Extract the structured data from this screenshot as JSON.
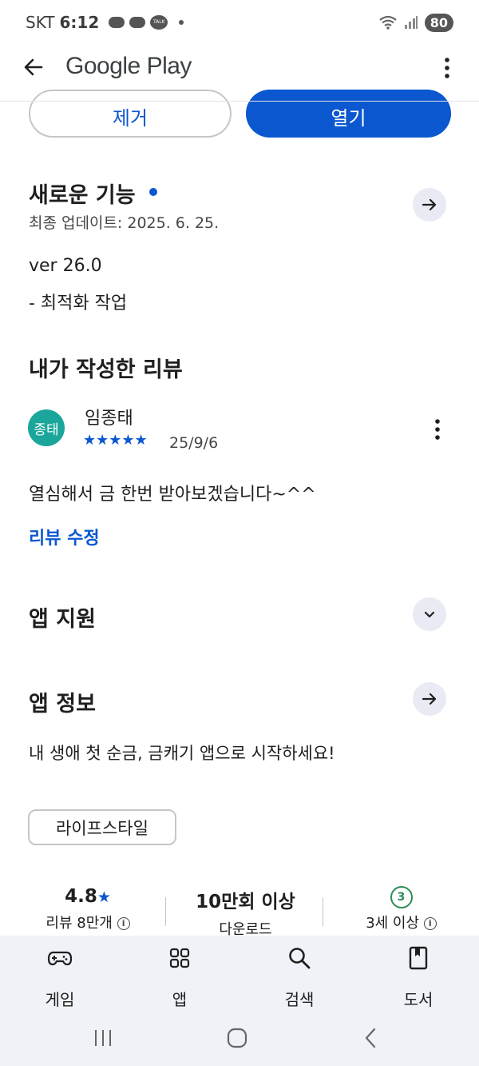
{
  "status_bar": {
    "carrier": "SKT",
    "time": "6:12",
    "talk_label": "TALK",
    "battery": "80"
  },
  "app_bar": {
    "title": "Google Play"
  },
  "actions": {
    "remove_label": "제거",
    "open_label": "열기"
  },
  "whats_new": {
    "title": "새로운 기능",
    "updated": "최종 업데이트: 2025. 6. 25.",
    "version": "ver 26.0",
    "note": "- 최적화 작업"
  },
  "my_review": {
    "title": "내가 작성한 리뷰",
    "avatar_text": "종태",
    "reviewer": "임종태",
    "stars": "★★★★★",
    "date": "25/9/6",
    "text": "열심해서 금 한번 받아보겠습니다~^^",
    "edit_label": "리뷰 수정"
  },
  "app_support": {
    "title": "앱 지원"
  },
  "app_info": {
    "title": "앱 정보",
    "description": "내 생애 첫 순금, 금캐기 앱으로 시작하세요!",
    "category_chip": "라이프스타일"
  },
  "stats": {
    "rating": "4.8",
    "rating_star": "★",
    "rating_label": "리뷰 8만개",
    "downloads": "10만회 이상",
    "downloads_label": "다운로드",
    "age_badge": "3",
    "age_label": "3세 이상"
  },
  "bottom_nav": {
    "games": "게임",
    "apps": "앱",
    "search": "검색",
    "books": "도서"
  },
  "colors": {
    "accent": "#0b57d0",
    "avatar_bg": "#1aa69a",
    "nav_bg": "#f0f2f8"
  }
}
